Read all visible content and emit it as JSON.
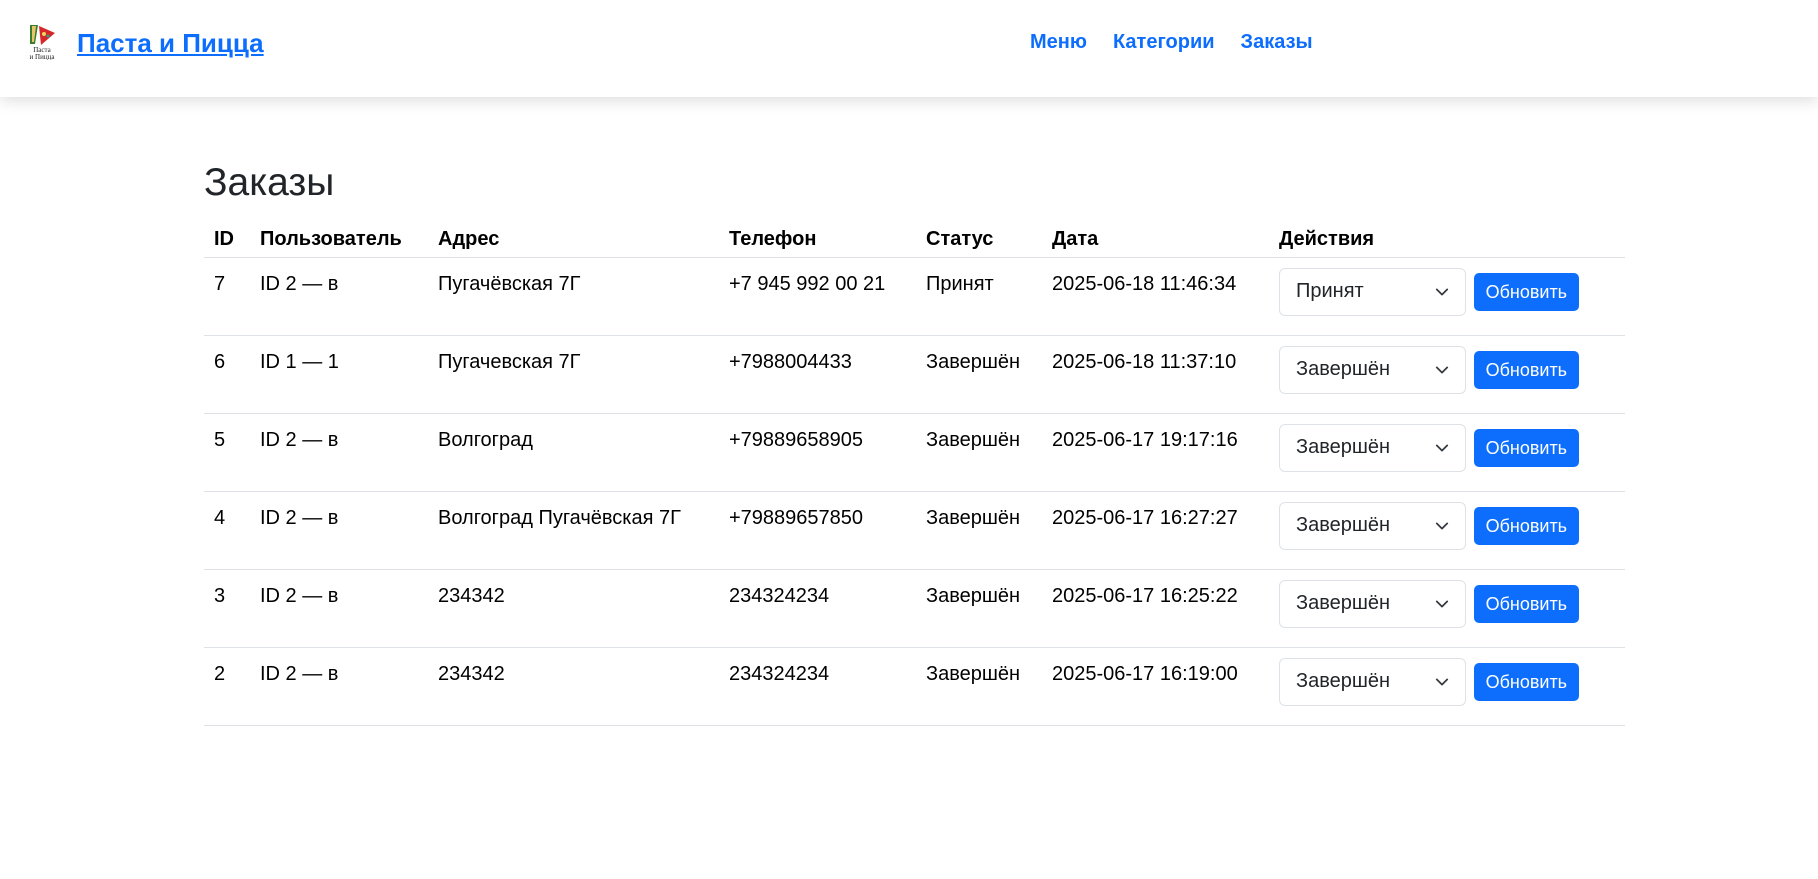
{
  "header": {
    "logo_alt": "Паста и Пицца",
    "brand": "Паста и Пицца",
    "nav": [
      "Меню",
      "Категории",
      "Заказы"
    ]
  },
  "page": {
    "title": "Заказы"
  },
  "table": {
    "columns": [
      "ID",
      "Пользователь",
      "Адрес",
      "Телефон",
      "Статус",
      "Дата",
      "Действия"
    ],
    "rows": [
      {
        "id": "7",
        "user": "ID 2 — в",
        "address": "Пугачёвская 7Г",
        "phone": "+7 945 992 00 21",
        "status": "Принят",
        "date": "2025-06-18 11:46:34",
        "select": "Принят",
        "button": "Обновить"
      },
      {
        "id": "6",
        "user": "ID 1 — 1",
        "address": "Пугачевская 7Г",
        "phone": "+7988004433",
        "status": "Завершён",
        "date": "2025-06-18 11:37:10",
        "select": "Завершён",
        "button": "Обновить"
      },
      {
        "id": "5",
        "user": "ID 2 — в",
        "address": "Волгоград",
        "phone": "+79889658905",
        "status": "Завершён",
        "date": "2025-06-17 19:17:16",
        "select": "Завершён",
        "button": "Обновить"
      },
      {
        "id": "4",
        "user": "ID 2 — в",
        "address": "Волгоград Пугачёвская 7Г",
        "phone": "+79889657850",
        "status": "Завершён",
        "date": "2025-06-17 16:27:27",
        "select": "Завершён",
        "button": "Обновить"
      },
      {
        "id": "3",
        "user": "ID 2 — в",
        "address": "234342",
        "phone": "234324234",
        "status": "Завершён",
        "date": "2025-06-17 16:25:22",
        "select": "Завершён",
        "button": "Обновить"
      },
      {
        "id": "2",
        "user": "ID 2 — в",
        "address": "234342",
        "phone": "234324234",
        "status": "Завершён",
        "date": "2025-06-17 16:19:00",
        "select": "Завершён",
        "button": "Обновить"
      }
    ]
  },
  "colors": {
    "accent": "#0d6efd",
    "text": "#212529",
    "border": "#dee2e6"
  },
  "icons": {
    "logo": "pizza-logo-icon",
    "select_arrow": "chevron-down-icon"
  }
}
